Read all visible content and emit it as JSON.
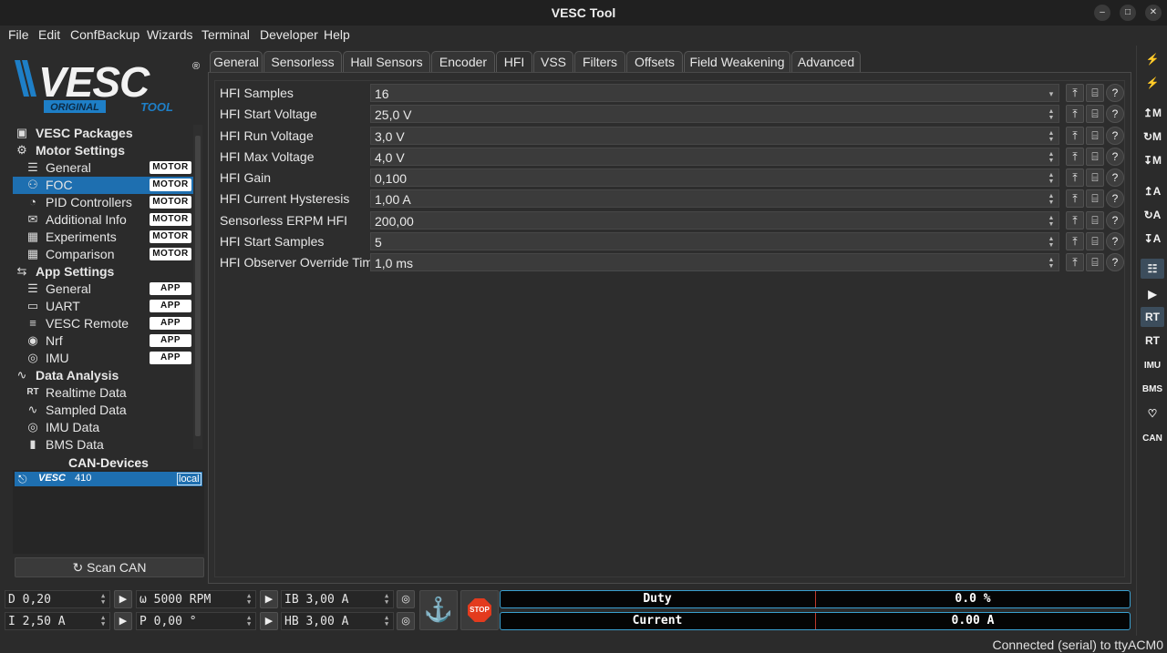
{
  "window": {
    "title": "VESC Tool",
    "controls": [
      "–",
      "□",
      "✕"
    ]
  },
  "menu": [
    "File",
    "Edit",
    "ConfBackup",
    "Wizards",
    "Terminal",
    "Developer",
    "Help"
  ],
  "logo": {
    "brand": "VESC",
    "sub_left": "ORIGINAL",
    "sub_right": "TOOL",
    "reg": "®"
  },
  "tree": {
    "vesc_packages": "VESC Packages",
    "motor_settings": "Motor Settings",
    "motor_items": [
      {
        "label": "General",
        "badge": "MOTOR",
        "icon": "☰"
      },
      {
        "label": "FOC",
        "badge": "MOTOR",
        "icon": "⚇"
      },
      {
        "label": "PID Controllers",
        "badge": "MOTOR",
        "icon": "◔"
      },
      {
        "label": "Additional Info",
        "badge": "MOTOR",
        "icon": "✉"
      },
      {
        "label": "Experiments",
        "badge": "MOTOR",
        "icon": "▦"
      },
      {
        "label": "Comparison",
        "badge": "MOTOR",
        "icon": "▦"
      }
    ],
    "app_settings": "App Settings",
    "app_items": [
      {
        "label": "General",
        "badge": "APP",
        "icon": "☰"
      },
      {
        "label": "UART",
        "badge": "APP",
        "icon": "▭"
      },
      {
        "label": "VESC Remote",
        "badge": "APP",
        "icon": "≡"
      },
      {
        "label": "Nrf",
        "badge": "APP",
        "icon": "◉"
      },
      {
        "label": "IMU",
        "badge": "APP",
        "icon": "◎"
      }
    ],
    "data_analysis": "Data Analysis",
    "data_items": [
      {
        "label": "Realtime Data",
        "icon": "RT"
      },
      {
        "label": "Sampled Data",
        "icon": "∿"
      },
      {
        "label": "IMU Data",
        "icon": "◎"
      },
      {
        "label": "BMS Data",
        "icon": "▮"
      }
    ]
  },
  "can_devices": {
    "title": "CAN-Devices",
    "device_brand": "VESC",
    "device_id": "410",
    "device_tag": "local",
    "scan_label": "Scan CAN",
    "scan_icon": "↻"
  },
  "tabs": [
    "General",
    "Sensorless",
    "Hall Sensors",
    "Encoder",
    "HFI",
    "VSS",
    "Filters",
    "Offsets",
    "Field Weakening",
    "Advanced"
  ],
  "active_tab": "HFI",
  "params": [
    {
      "label": "HFI Samples",
      "value": "16",
      "kind": "dropdown"
    },
    {
      "label": "HFI Start Voltage",
      "value": "25,0 V",
      "kind": "spin"
    },
    {
      "label": "HFI Run Voltage",
      "value": "3,0 V",
      "kind": "spin"
    },
    {
      "label": "HFI Max Voltage",
      "value": "4,0 V",
      "kind": "spin"
    },
    {
      "label": "HFI Gain",
      "value": "0,100",
      "kind": "spin"
    },
    {
      "label": "HFI Current Hysteresis",
      "value": "1,00 A",
      "kind": "spin"
    },
    {
      "label": "Sensorless ERPM HFI",
      "value": "200,00",
      "kind": "spin"
    },
    {
      "label": "HFI Start Samples",
      "value": "5",
      "kind": "spin"
    },
    {
      "label": "HFI Observer Override Time",
      "value": "1,0 ms",
      "kind": "spin"
    }
  ],
  "param_buttons": {
    "upload_icon": "⤒",
    "read_icon": "⌸",
    "help_icon": "?"
  },
  "rightbar": [
    {
      "name": "connect-icon",
      "glyph": "⚡"
    },
    {
      "name": "disconnect-icon",
      "glyph": "⚡"
    },
    {
      "name": "read-motor-config-icon",
      "glyph": "↥M"
    },
    {
      "name": "default-motor-config-icon",
      "glyph": "↻M"
    },
    {
      "name": "write-motor-config-icon",
      "glyph": "↧M"
    },
    {
      "name": "read-app-config-icon",
      "glyph": "↥A"
    },
    {
      "name": "default-app-config-icon",
      "glyph": "↻A"
    },
    {
      "name": "write-app-config-icon",
      "glyph": "↧A"
    },
    {
      "name": "can-network-icon",
      "glyph": "☷"
    },
    {
      "name": "gamepad-icon",
      "glyph": "▶"
    },
    {
      "name": "rt-data-icon",
      "glyph": "RT"
    },
    {
      "name": "rt-app-icon",
      "glyph": "RT"
    },
    {
      "name": "imu-icon",
      "glyph": "IMU"
    },
    {
      "name": "bms-icon",
      "glyph": "BMS"
    },
    {
      "name": "heart-icon",
      "glyph": "♡"
    },
    {
      "name": "can-icon",
      "glyph": "CAN"
    }
  ],
  "controls": {
    "duty": "D 0,20",
    "speed": "ω 5000 RPM",
    "ib": "IB 3,00 A",
    "current": "I 2,50 A",
    "position": "P 0,00 °",
    "hb": "HB 3,00 A",
    "play_icon": "▶",
    "loop_icon": "◎",
    "anchor_icon": "⚓",
    "stop_label": "STOP"
  },
  "meters": [
    {
      "label": "Duty",
      "value": "0.0 %"
    },
    {
      "label": "Current",
      "value": "0.00 A"
    }
  ],
  "status": "Connected (serial) to ttyACM0",
  "colors": {
    "accent": "#1e6fb0",
    "stop": "#e33b1e",
    "meter_border": "#3aa0d0"
  }
}
